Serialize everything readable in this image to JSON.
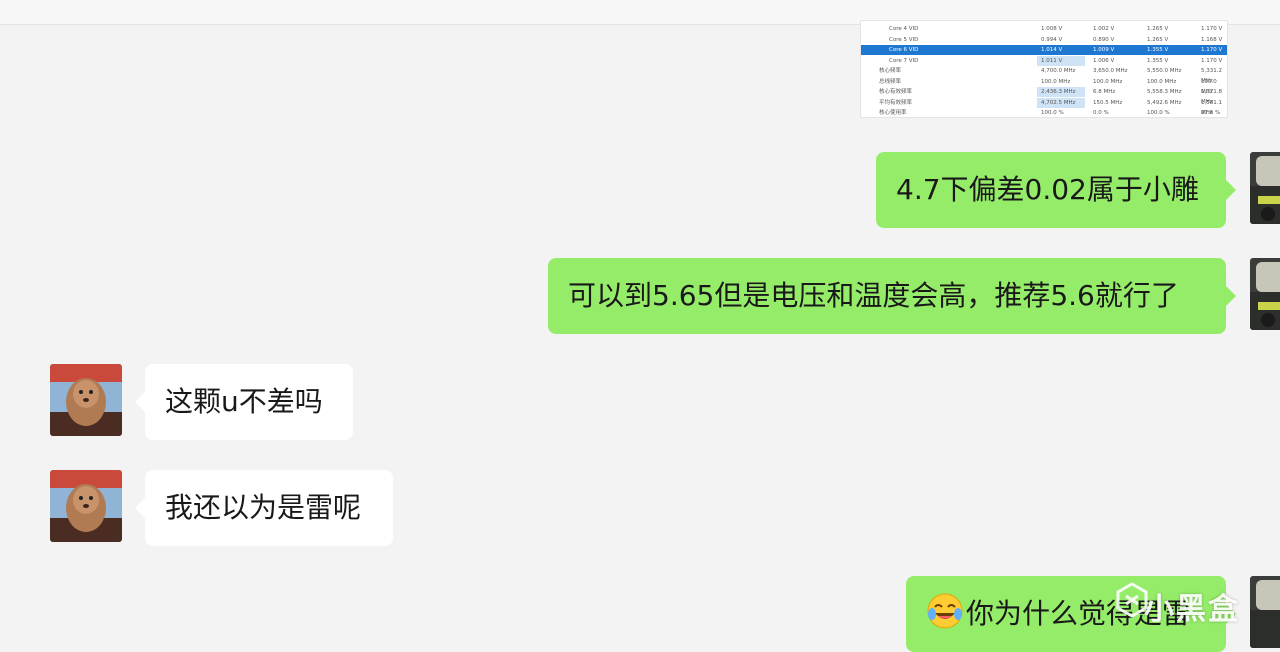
{
  "screenshot_table": {
    "rows": [
      {
        "name": "Core 4 VID",
        "v": [
          "1.008 V",
          "1.002 V",
          "1.265 V",
          "1.170 V"
        ]
      },
      {
        "name": "Core 5 VID",
        "v": [
          "0.994 V",
          "0.890 V",
          "1.265 V",
          "1.168 V"
        ]
      },
      {
        "name": "Core 6 VID",
        "v": [
          "1.014 V",
          "1.009 V",
          "1.355 V",
          "1.170 V"
        ],
        "selected": true
      },
      {
        "name": "Core 7 VID",
        "v": [
          "1.011 V",
          "1.006 V",
          "1.355 V",
          "1.170 V"
        ]
      },
      {
        "name": "核心频率",
        "v": [
          "4,700.0 MHz",
          "3,650.0 MHz",
          "5,550.0 MHz",
          "5,331.2 MHz"
        ]
      },
      {
        "name": "总线频率",
        "v": [
          "100.0 MHz",
          "100.0 MHz",
          "100.0 MHz",
          "100.0 MHz"
        ]
      },
      {
        "name": "核心有效频率",
        "v": [
          "2,436.3 MHz",
          "6.8 MHz",
          "5,558.3 MHz",
          "1,371.8 MHz"
        ]
      },
      {
        "name": "平均有效频率",
        "v": [
          "4,702.5 MHz",
          "150.5 MHz",
          "5,492.6 MHz",
          "1,581.1 MHz"
        ]
      },
      {
        "name": "核心使用率",
        "v": [
          "100.0 %",
          "0.0 %",
          "100.0 %",
          "27.6 %"
        ]
      }
    ]
  },
  "messages": [
    {
      "side": "me",
      "text": "4.7下偏差0.02属于小雕"
    },
    {
      "side": "me",
      "text": "可以到5.65但是电压和温度会高，推荐5.6就行了"
    },
    {
      "side": "other",
      "text": "这颗u不差吗"
    },
    {
      "side": "other",
      "text": "我还以为是雷呢"
    },
    {
      "side": "me",
      "text": "你为什么觉得是雷",
      "emoji": "joy-tears-emoji"
    }
  ],
  "watermark": {
    "text": "小黑盒"
  },
  "colors": {
    "me_bubble": "#95ec69",
    "other_bubble": "#ffffff",
    "background": "#f3f3f3"
  }
}
